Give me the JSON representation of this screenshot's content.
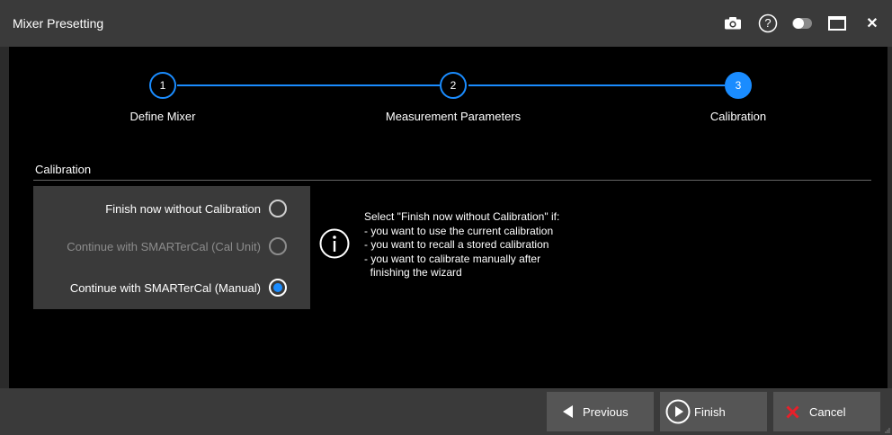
{
  "window": {
    "title": "Mixer Presetting"
  },
  "toolbar": {
    "icons": [
      "camera-icon",
      "help-icon",
      "toggle-icon",
      "maximize-icon",
      "close-icon"
    ],
    "help_glyph": "?",
    "close_glyph": "✕"
  },
  "steps": [
    {
      "number": "1",
      "label": "Define Mixer",
      "state": "done"
    },
    {
      "number": "2",
      "label": "Measurement Parameters",
      "state": "done"
    },
    {
      "number": "3",
      "label": "Calibration",
      "state": "active"
    }
  ],
  "calibration": {
    "section_label": "Calibration",
    "options": [
      {
        "label": "Finish now without Calibration",
        "selected": false,
        "enabled": true
      },
      {
        "label": "Continue with SMARTerCal (Cal Unit)",
        "selected": false,
        "enabled": false
      },
      {
        "label": "Continue with SMARTerCal (Manual)",
        "selected": true,
        "enabled": true
      }
    ],
    "info_lines": [
      "Select \"Finish now without Calibration\" if:",
      "- you want to use the current calibration",
      "- you want to recall a stored calibration",
      "- you want to calibrate manually after",
      "  finishing the wizard"
    ]
  },
  "footer": {
    "previous_label": "Previous",
    "finish_label": "Finish",
    "cancel_label": "Cancel"
  },
  "colors": {
    "accent": "#1a8cff",
    "cancel_x": "#e8202a",
    "background": "#000000",
    "chrome": "#3a3a3a"
  }
}
